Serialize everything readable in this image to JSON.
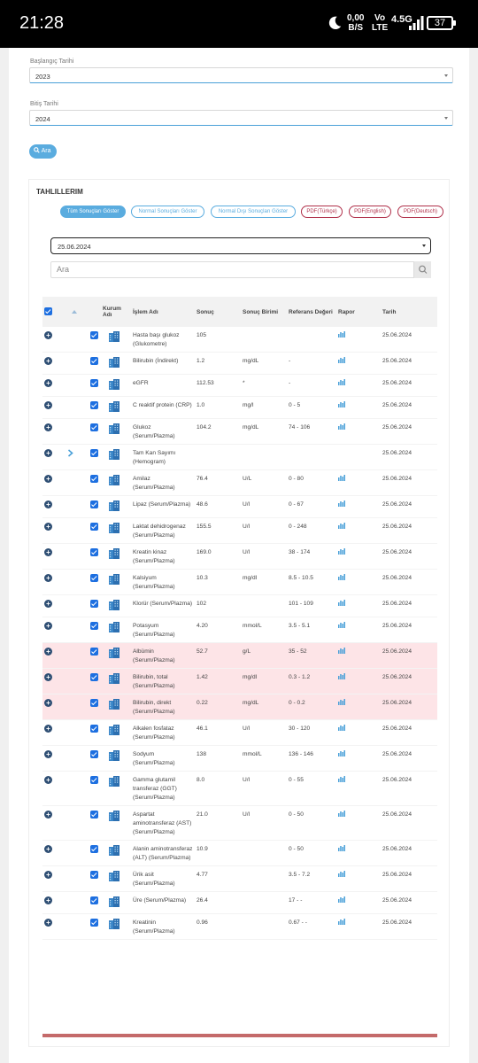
{
  "status_bar": {
    "time": "21:28",
    "data_rate": "0,00",
    "data_unit": "B/S",
    "volte_top": "Vo",
    "volte_bottom": "LTE",
    "network": "4.5G",
    "battery": "37"
  },
  "form": {
    "start_label": "Başlangıç Tarihi",
    "start_value": "2023",
    "end_label": "Bitiş Tarihi",
    "end_value": "2024",
    "search_button": "Ara"
  },
  "panel": {
    "title": "TAHLILLERIM",
    "filters": [
      "Tüm Sonuçları Göster",
      "Normal Sonuçları Göster",
      "Normal Dışı Sonuçları Göster",
      "PDF(Türkçe)",
      "PDF(English)",
      "PDF(Deutsch)"
    ],
    "date_select": "25.06.2024",
    "search_placeholder": "Ara"
  },
  "table": {
    "headers": {
      "kurum": "Kurum Adı",
      "islem": "İşlem Adı",
      "sonuc": "Sonuç",
      "birim": "Sonuç Birimi",
      "referans": "Referans Değeri",
      "rapor": "Rapor",
      "tarih": "Tarih"
    },
    "rows": [
      {
        "name": "Hasta başı glukoz (Glukometre)",
        "result": "105",
        "unit": "",
        "ref": "",
        "date": "25.06.2024",
        "hi": false,
        "report": true
      },
      {
        "name": "Bilirubin (İndirekt)",
        "result": "1.2",
        "unit": "mg/dL",
        "ref": "-",
        "date": "25.06.2024",
        "hi": false,
        "report": true
      },
      {
        "name": "eGFR",
        "result": "112.53",
        "unit": "*",
        "ref": "-",
        "date": "25.06.2024",
        "hi": false,
        "report": true
      },
      {
        "name": "C reaktif protein (CRP)",
        "result": "1.0",
        "unit": "mg/l",
        "ref": "0 - 5",
        "date": "25.06.2024",
        "hi": false,
        "report": true
      },
      {
        "name": "Glukoz (Serum/Plazma)",
        "result": "104.2",
        "unit": "mg/dL",
        "ref": "74 - 106",
        "date": "25.06.2024",
        "hi": false,
        "report": true
      },
      {
        "name": "Tam Kan Sayımı (Hemogram)",
        "result": "",
        "unit": "",
        "ref": "",
        "date": "25.06.2024",
        "hi": false,
        "report": false,
        "expand": true
      },
      {
        "name": "Amilaz (Serum/Plazma)",
        "result": "76.4",
        "unit": "U/L",
        "ref": "0 - 80",
        "date": "25.06.2024",
        "hi": false,
        "report": true
      },
      {
        "name": "Lipaz (Serum/Plazma)",
        "result": "48.6",
        "unit": "U/l",
        "ref": "0 - 67",
        "date": "25.06.2024",
        "hi": false,
        "report": true
      },
      {
        "name": "Laktat dehidrogenaz (Serum/Plazma)",
        "result": "155.5",
        "unit": "U/l",
        "ref": "0 - 248",
        "date": "25.06.2024",
        "hi": false,
        "report": true
      },
      {
        "name": "Kreatin kinaz (Serum/Plazma)",
        "result": "169.0",
        "unit": "U/l",
        "ref": "38 - 174",
        "date": "25.06.2024",
        "hi": false,
        "report": true
      },
      {
        "name": "Kalsiyum (Serum/Plazma)",
        "result": "10.3",
        "unit": "mg/dl",
        "ref": "8.5 - 10.5",
        "date": "25.06.2024",
        "hi": false,
        "report": true
      },
      {
        "name": "Klorür (Serum/Plazma)",
        "result": "102",
        "unit": "",
        "ref": "101 - 109",
        "date": "25.06.2024",
        "hi": false,
        "report": true
      },
      {
        "name": "Potasyum (Serum/Plazma)",
        "result": "4.20",
        "unit": "mmol/L",
        "ref": "3.5 - 5.1",
        "date": "25.06.2024",
        "hi": false,
        "report": true
      },
      {
        "name": "Albümin (Serum/Plazma)",
        "result": "52.7",
        "unit": "g/L",
        "ref": "35 - 52",
        "date": "25.06.2024",
        "hi": true,
        "report": true
      },
      {
        "name": "Bilirubin, total (Serum/Plazma)",
        "result": "1.42",
        "unit": "mg/dl",
        "ref": "0.3 - 1.2",
        "date": "25.06.2024",
        "hi": true,
        "report": true
      },
      {
        "name": "Bilirubin, direkt (Serum/Plazma)",
        "result": "0.22",
        "unit": "mg/dL",
        "ref": "0 - 0.2",
        "date": "25.06.2024",
        "hi": true,
        "report": true
      },
      {
        "name": "Alkalen fosfataz (Serum/Plazma)",
        "result": "46.1",
        "unit": "U/l",
        "ref": "30 - 120",
        "date": "25.06.2024",
        "hi": false,
        "report": true
      },
      {
        "name": "Sodyum (Serum/Plazma)",
        "result": "138",
        "unit": "mmol/L",
        "ref": "136 - 146",
        "date": "25.06.2024",
        "hi": false,
        "report": true
      },
      {
        "name": "Gamma glutamil transferaz (GGT) (Serum/Plazma)",
        "result": "8.0",
        "unit": "U/l",
        "ref": "0 - 55",
        "date": "25.06.2024",
        "hi": false,
        "report": true
      },
      {
        "name": "Aspartat aminotransferaz (AST) (Serum/Plazma)",
        "result": "21.0",
        "unit": "U/l",
        "ref": "0 - 50",
        "date": "25.06.2024",
        "hi": false,
        "report": true
      },
      {
        "name": "Alanin aminotransferaz (ALT) (Serum/Plazma)",
        "result": "10.9",
        "unit": "",
        "ref": "0 - 50",
        "date": "25.06.2024",
        "hi": false,
        "report": true
      },
      {
        "name": "Ürik asit (Serum/Plazma)",
        "result": "4.77",
        "unit": "",
        "ref": "3.5 - 7.2",
        "date": "25.06.2024",
        "hi": false,
        "report": true
      },
      {
        "name": "Üre (Serum/Plazma)",
        "result": "26.4",
        "unit": "",
        "ref": "17 - -",
        "date": "25.06.2024",
        "hi": false,
        "report": true
      },
      {
        "name": "Kreatinin (Serum/Plazma)",
        "result": "0.96",
        "unit": "",
        "ref": "0.67 - -",
        "date": "25.06.2024",
        "hi": false,
        "report": true
      }
    ]
  },
  "colors": {
    "accent": "#5aacdf",
    "pdf_red": "#b0304a",
    "abnormal_row": "#fde4e7",
    "checkbox": "#1d6fe0"
  }
}
